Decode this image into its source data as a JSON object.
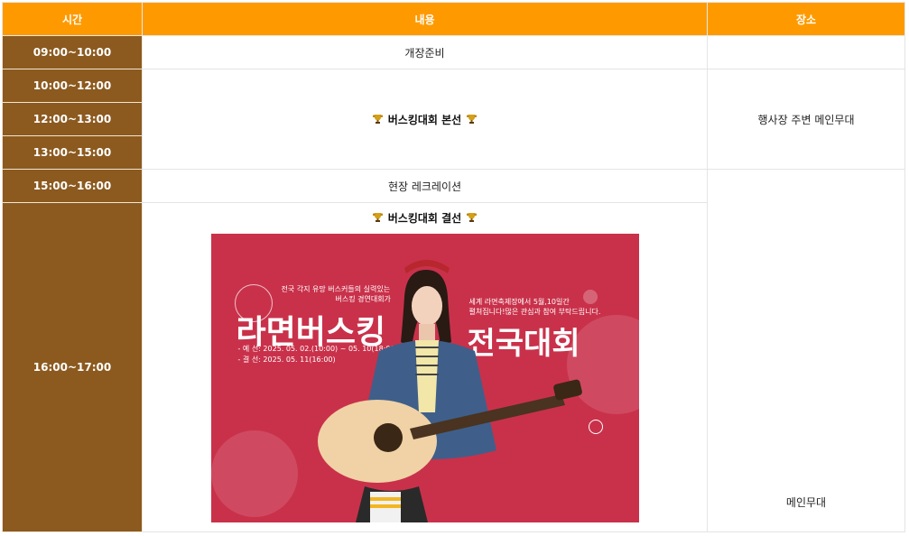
{
  "header": {
    "time": "시간",
    "content": "내용",
    "place": "장소"
  },
  "rows": {
    "r1": {
      "time": "09:00~10:00",
      "content": "개장준비",
      "place": ""
    },
    "r2": {
      "time": "10:00~12:00"
    },
    "r3": {
      "time": "12:00~13:00"
    },
    "r4": {
      "time": "13:00~15:00"
    },
    "main_content": "버스킹대회 본선",
    "main_place": "행사장 주변 메인무대",
    "r5": {
      "time": "15:00~16:00",
      "content": "현장 레크레이션"
    },
    "r6": {
      "time": "16:00~17:00",
      "content": "버스킹대회 결선"
    },
    "lower_place": "메인무대"
  },
  "poster": {
    "title_left": "라면버스킹",
    "title_right": "전국대회",
    "intro_line1": "전국 각지 유망 버스커들의 실력있는",
    "intro_line2": "버스킹 경연대회가",
    "prelim": "- 예  선: 2025. 05. 02.(10:00) ~ 05. 10(18:00)",
    "final": "- 결  선: 2025. 05. 11(16:00)",
    "notice_line1": "세계 라면축제장에서 5월,10일간",
    "notice_line2": "펼쳐집니다!많은 관심과 참여 부탁드립니다.",
    "bg_color": "#c9314a"
  },
  "colors": {
    "header": "#fe9a00",
    "time_cell": "#8c5a1f"
  }
}
